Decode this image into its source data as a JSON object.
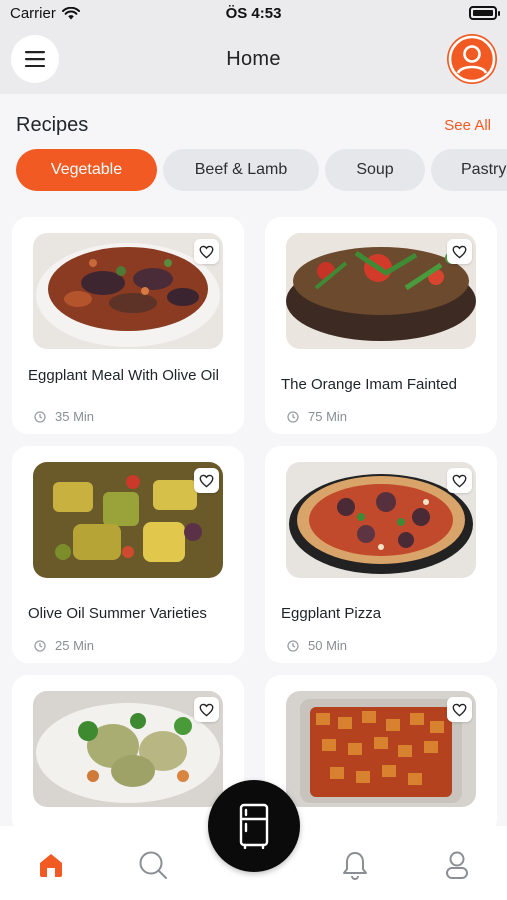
{
  "status_bar": {
    "carrier": "Carrier",
    "time": "ÖS 4:53"
  },
  "header": {
    "title": "Home",
    "menu_icon": "hamburger-menu-icon",
    "profile_icon": "user-avatar-icon"
  },
  "recipes_section": {
    "title": "Recipes",
    "see_all": "See All"
  },
  "categories": [
    {
      "label": "Vegetable",
      "active": true
    },
    {
      "label": "Beef & Lamb",
      "active": false
    },
    {
      "label": "Soup",
      "active": false
    },
    {
      "label": "Pastry",
      "active": false
    }
  ],
  "recipes": [
    {
      "name": "Eggplant Meal With Olive Oil",
      "time": "35 Min"
    },
    {
      "name": "The Orange Imam Fainted",
      "time": "75 Min"
    },
    {
      "name": "Olive Oil Summer Varieties",
      "time": "25 Min"
    },
    {
      "name": "Eggplant Pizza",
      "time": "50 Min"
    },
    {
      "name": "",
      "time": ""
    },
    {
      "name": "",
      "time": ""
    }
  ],
  "tabbar": {
    "items": [
      "home-icon",
      "search-icon",
      "fridge-icon",
      "bell-icon",
      "profile-icon"
    ],
    "active": "home-icon"
  },
  "colors": {
    "accent": "#F15A22",
    "fab": "#0B0B0C",
    "chip_bg": "#E6E7EA"
  }
}
